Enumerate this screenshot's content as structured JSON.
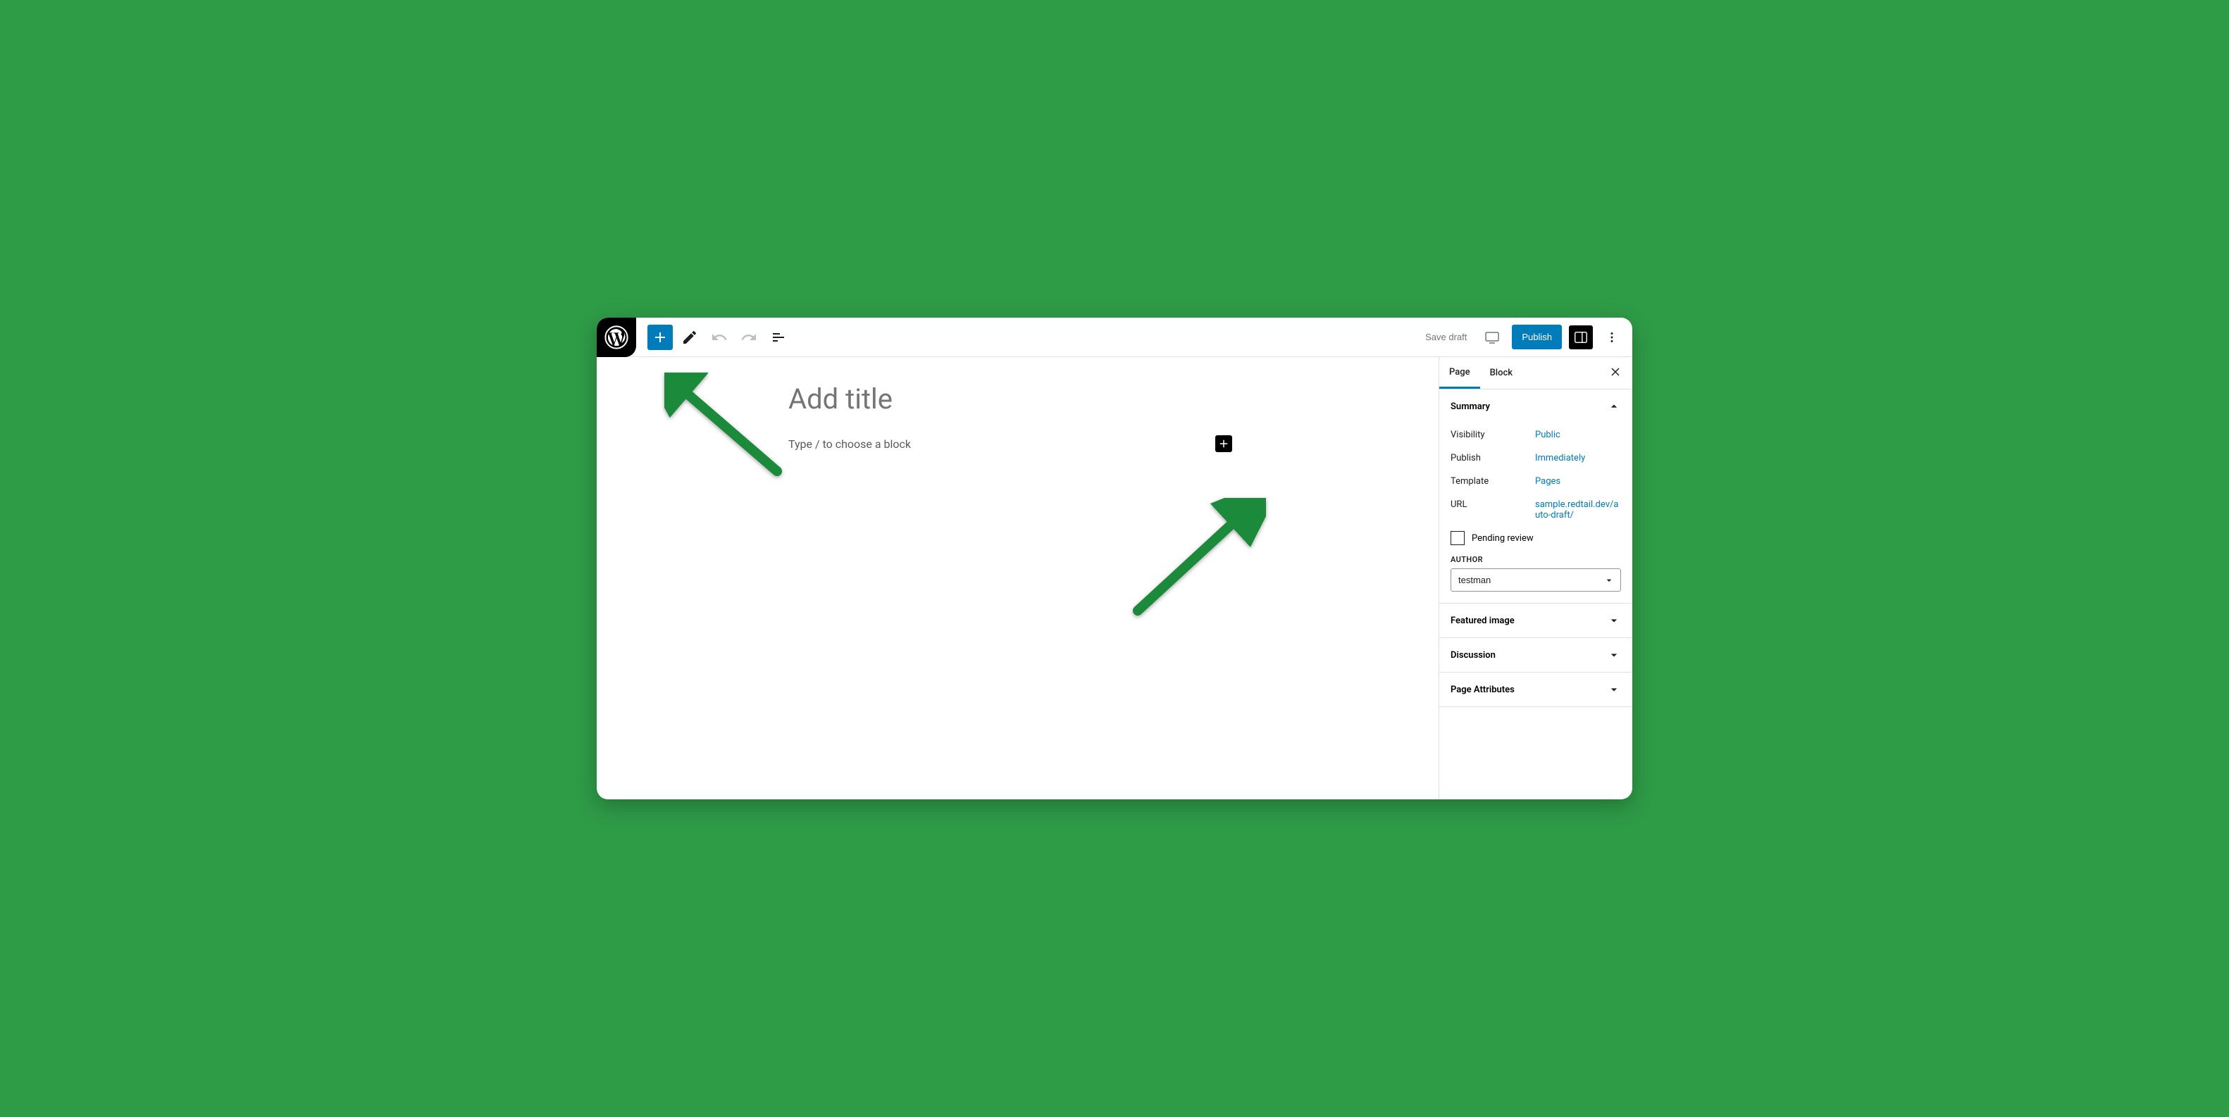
{
  "topbar": {
    "save_draft": "Save draft",
    "publish": "Publish"
  },
  "editor": {
    "title_placeholder": "Add title",
    "block_placeholder": "Type / to choose a block"
  },
  "sidebar": {
    "tabs": {
      "page": "Page",
      "block": "Block"
    },
    "summary": {
      "title": "Summary",
      "visibility_label": "Visibility",
      "visibility_value": "Public",
      "publish_label": "Publish",
      "publish_value": "Immediately",
      "template_label": "Template",
      "template_value": "Pages",
      "url_label": "URL",
      "url_value": "sample.redtail.dev/auto-draft/",
      "pending_review": "Pending review",
      "author_label": "AUTHOR",
      "author_value": "testman"
    },
    "panels": {
      "featured_image": "Featured image",
      "discussion": "Discussion",
      "page_attributes": "Page Attributes"
    }
  },
  "colors": {
    "accent": "#007cba",
    "green_bg": "#2e9b47",
    "arrow": "#1b8a3a"
  }
}
